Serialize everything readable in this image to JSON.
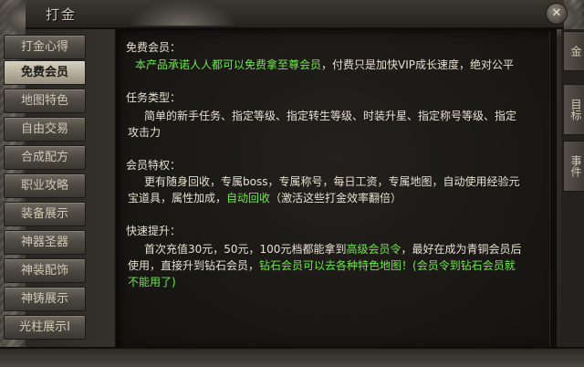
{
  "window": {
    "title": "打金",
    "close_label": "✕"
  },
  "sidebar": {
    "items": [
      {
        "label": "打金心得"
      },
      {
        "label": "免费会员",
        "active": true
      },
      {
        "label": "地图特色"
      },
      {
        "label": "自由交易"
      },
      {
        "label": "合成配方"
      },
      {
        "label": "职业攻略"
      },
      {
        "label": "装备展示"
      },
      {
        "label": "神器圣器"
      },
      {
        "label": "神装配饰"
      },
      {
        "label": "神铸展示"
      },
      {
        "label": "光柱展示I"
      }
    ]
  },
  "right_tabs": [
    {
      "label": "金"
    },
    {
      "label": "目标"
    },
    {
      "label": "事件"
    }
  ],
  "content": {
    "s1_title": "免费会员：",
    "s1_l1": "本产品承诺人人都可以免费拿至尊会员",
    "s1_l1b": "，付费只是加快VIP成长速度，绝对公平",
    "s2_title": "任务类型：",
    "s2_l1": "简单的新手任务、指定等级、指定转生等级、时装升星、指定称号等级、指定",
    "s2_l2": "攻击力",
    "s3_title": "会员特权：",
    "s3_l1": "更有随身回收，专属boss，专属称号，每日工资，专属地图，自动使用经验元",
    "s3_l2a": "宝道具，属性加成，",
    "s3_l2b": "自动回收",
    "s3_l2c": "（激活这些打金效率翻倍）",
    "s4_title": "快速提升：",
    "s4_l1a": "首次充值30元，50元，100元档都能拿到",
    "s4_l1b": "高级会员令",
    "s4_l1c": "，最好在成为青铜会员后",
    "s4_l2a": "使用，直接升到钻石会员，",
    "s4_l2b": "钻石会员可以去各种特色地图！(会员令到钻石会员就",
    "s4_l3": "不能用了)"
  },
  "colors": {
    "highlight": "#6ee84a",
    "text": "#e6e0d2",
    "active_tab": "#c8c1b0"
  }
}
